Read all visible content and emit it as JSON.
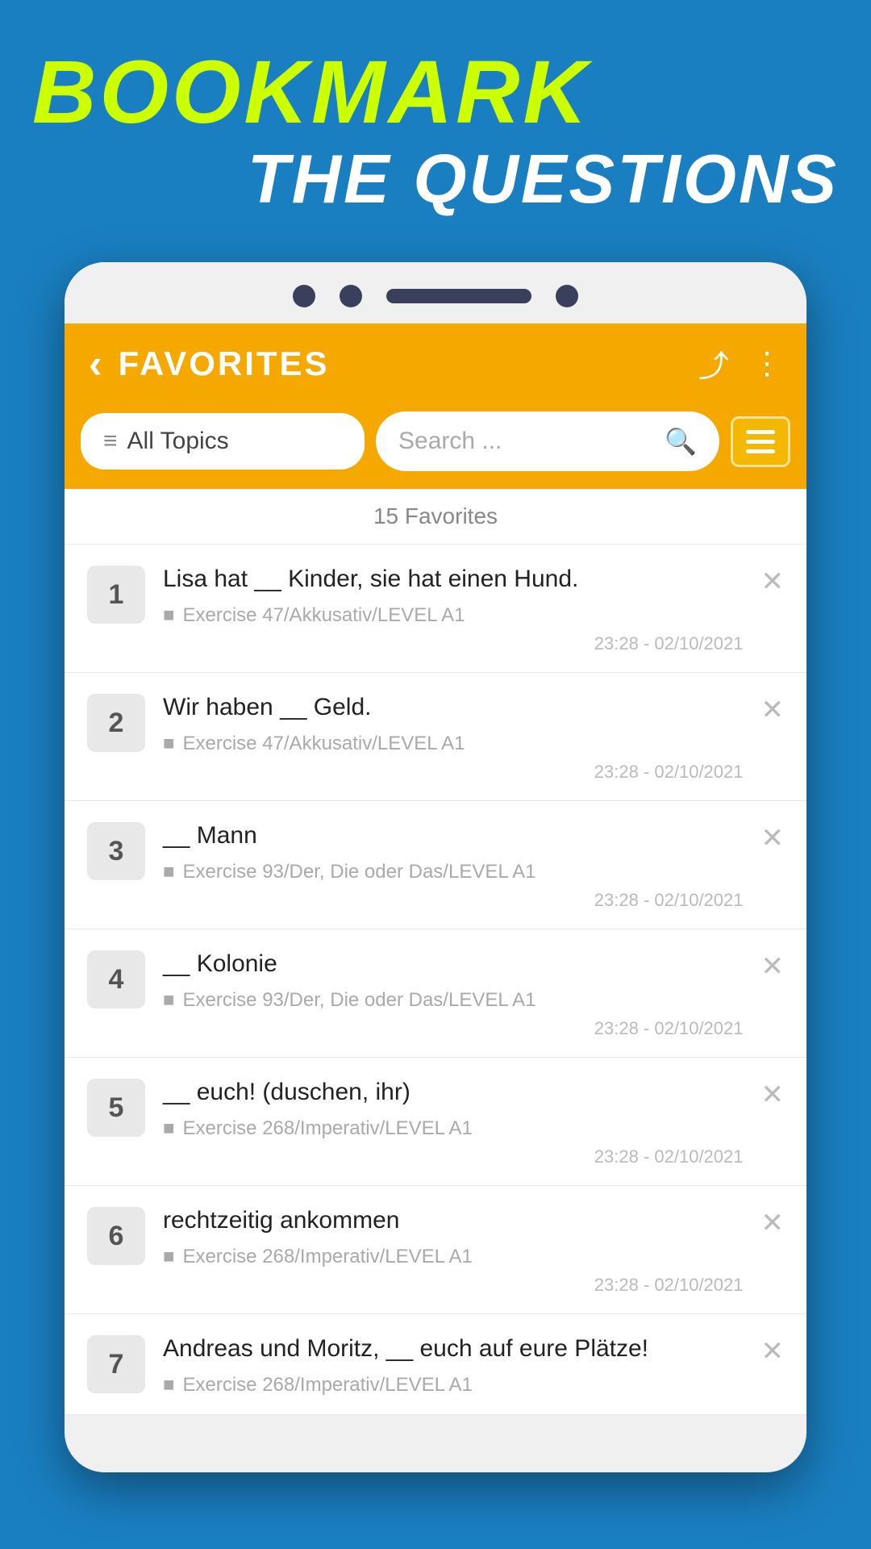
{
  "headlines": {
    "bookmark": "BOOKMARK",
    "questions": "THE QUESTIONS"
  },
  "phone": {
    "dots": [
      true,
      true
    ],
    "pill": true,
    "dot_right": true
  },
  "header": {
    "title": "FAVORITES",
    "back_label": "‹",
    "share_label": "⤴",
    "more_label": "⋮"
  },
  "filter": {
    "label": "All Topics",
    "icon": "≡"
  },
  "search": {
    "placeholder": "Search ...",
    "icon": "🔍"
  },
  "menu_icon": "☰",
  "list_count": "15 Favorites",
  "items": [
    {
      "number": "1",
      "question": "Lisa hat __ Kinder, sie hat einen Hund.",
      "sub": "Exercise 47/Akkusativ/LEVEL A1",
      "timestamp": "23:28 - 02/10/2021"
    },
    {
      "number": "2",
      "question": "Wir haben __ Geld.",
      "sub": "Exercise 47/Akkusativ/LEVEL A1",
      "timestamp": "23:28 - 02/10/2021"
    },
    {
      "number": "3",
      "question": "__ Mann",
      "sub": "Exercise 93/Der, Die oder Das/LEVEL A1",
      "timestamp": "23:28 - 02/10/2021"
    },
    {
      "number": "4",
      "question": "__ Kolonie",
      "sub": "Exercise 93/Der, Die oder Das/LEVEL A1",
      "timestamp": "23:28 - 02/10/2021"
    },
    {
      "number": "5",
      "question": "__ euch! (duschen, ihr)",
      "sub": "Exercise 268/Imperativ/LEVEL A1",
      "timestamp": "23:28 - 02/10/2021"
    },
    {
      "number": "6",
      "question": "rechtzeitig ankommen",
      "sub": "Exercise 268/Imperativ/LEVEL A1",
      "timestamp": "23:28 - 02/10/2021"
    },
    {
      "number": "7",
      "question": "Andreas und Moritz, __ euch auf eure Plätze!",
      "sub": "Exercise 268/Imperativ/LEVEL A1",
      "timestamp": ""
    }
  ],
  "colors": {
    "background": "#1a7fc1",
    "header_bg": "#f5a800",
    "headline_yellow": "#ccff00",
    "headline_white": "#ffffff"
  }
}
